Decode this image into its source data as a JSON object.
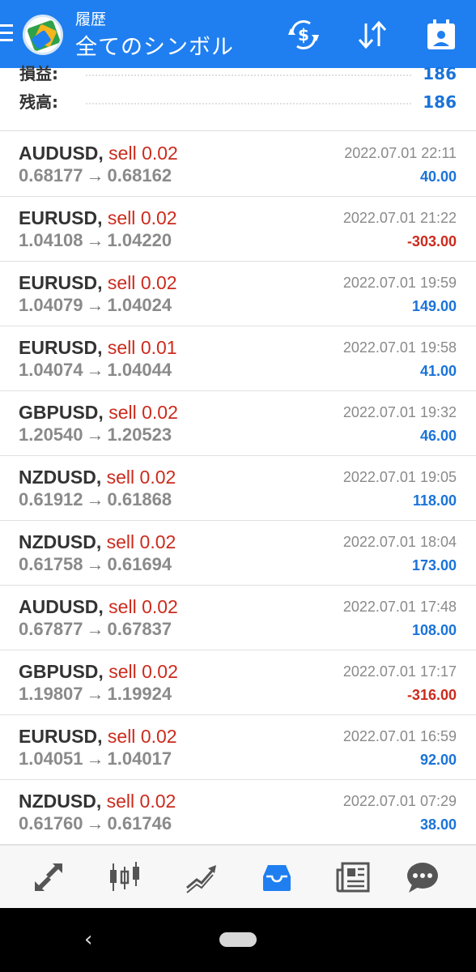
{
  "header": {
    "subtitle": "履歴",
    "title": "全てのシンボル",
    "icons": [
      "menu-icon",
      "metatrader-logo",
      "currency-exchange-icon",
      "sort-icon",
      "calendar-icon"
    ]
  },
  "summary": {
    "rows": [
      {
        "label": "損益:",
        "value": "186"
      },
      {
        "label": "残高:",
        "value": "186"
      }
    ]
  },
  "deals": [
    {
      "symbol": "AUDUSD",
      "side": "sell",
      "volume": "0.02",
      "open": "0.68177",
      "close": "0.68162",
      "time": "2022.07.01 22:11",
      "profit": "40.00",
      "sign": "pos"
    },
    {
      "symbol": "EURUSD",
      "side": "sell",
      "volume": "0.02",
      "open": "1.04108",
      "close": "1.04220",
      "time": "2022.07.01 21:22",
      "profit": "-303.00",
      "sign": "neg"
    },
    {
      "symbol": "EURUSD",
      "side": "sell",
      "volume": "0.02",
      "open": "1.04079",
      "close": "1.04024",
      "time": "2022.07.01 19:59",
      "profit": "149.00",
      "sign": "pos"
    },
    {
      "symbol": "EURUSD",
      "side": "sell",
      "volume": "0.01",
      "open": "1.04074",
      "close": "1.04044",
      "time": "2022.07.01 19:58",
      "profit": "41.00",
      "sign": "pos"
    },
    {
      "symbol": "GBPUSD",
      "side": "sell",
      "volume": "0.02",
      "open": "1.20540",
      "close": "1.20523",
      "time": "2022.07.01 19:32",
      "profit": "46.00",
      "sign": "pos"
    },
    {
      "symbol": "NZDUSD",
      "side": "sell",
      "volume": "0.02",
      "open": "0.61912",
      "close": "0.61868",
      "time": "2022.07.01 19:05",
      "profit": "118.00",
      "sign": "pos"
    },
    {
      "symbol": "NZDUSD",
      "side": "sell",
      "volume": "0.02",
      "open": "0.61758",
      "close": "0.61694",
      "time": "2022.07.01 18:04",
      "profit": "173.00",
      "sign": "pos"
    },
    {
      "symbol": "AUDUSD",
      "side": "sell",
      "volume": "0.02",
      "open": "0.67877",
      "close": "0.67837",
      "time": "2022.07.01 17:48",
      "profit": "108.00",
      "sign": "pos"
    },
    {
      "symbol": "GBPUSD",
      "side": "sell",
      "volume": "0.02",
      "open": "1.19807",
      "close": "1.19924",
      "time": "2022.07.01 17:17",
      "profit": "-316.00",
      "sign": "neg"
    },
    {
      "symbol": "EURUSD",
      "side": "sell",
      "volume": "0.02",
      "open": "1.04051",
      "close": "1.04017",
      "time": "2022.07.01 16:59",
      "profit": "92.00",
      "sign": "pos"
    },
    {
      "symbol": "NZDUSD",
      "side": "sell",
      "volume": "0.02",
      "open": "0.61760",
      "close": "0.61746",
      "time": "2022.07.01 07:29",
      "profit": "38.00",
      "sign": "pos"
    }
  ],
  "symbols": {
    "separator": ",",
    "arrow": "→"
  },
  "tabs": [
    {
      "name": "quotes-tab",
      "icon": "quotes-icon",
      "active": false
    },
    {
      "name": "chart-tab",
      "icon": "candlestick-icon",
      "active": false
    },
    {
      "name": "trade-tab",
      "icon": "trade-icon",
      "active": false
    },
    {
      "name": "history-tab",
      "icon": "inbox-icon",
      "active": true
    },
    {
      "name": "news-tab",
      "icon": "news-icon",
      "active": false
    },
    {
      "name": "messages-tab",
      "icon": "chat-icon",
      "active": false
    }
  ],
  "colors": {
    "header_bg": "#1f7ff0",
    "profit_positive": "#1a73d9",
    "profit_negative": "#cc2b1d",
    "sell": "#cc2b1d",
    "tab_active": "#1f7ff0",
    "tab_inactive": "#555555"
  },
  "sysnav": {
    "back": "‹"
  }
}
